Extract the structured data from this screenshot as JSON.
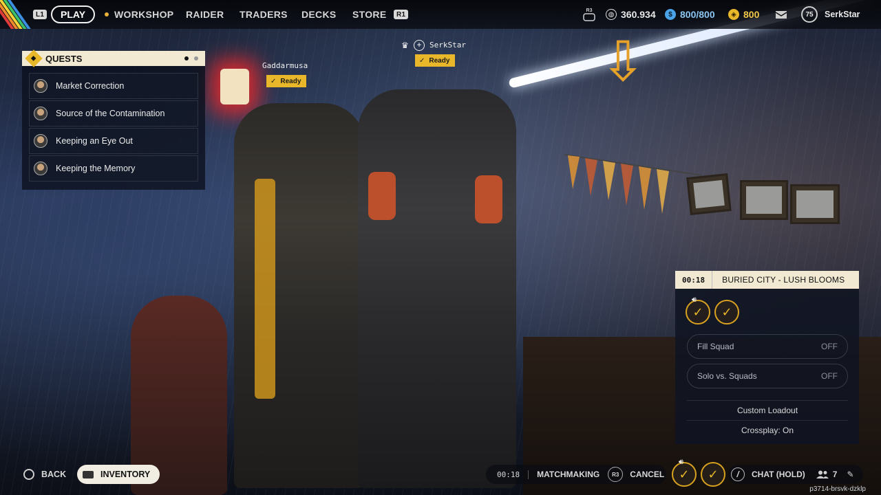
{
  "topbar": {
    "left_bumper": "L1",
    "right_bumper": "R1",
    "tabs": [
      {
        "label": "PLAY",
        "active": true
      },
      {
        "label": "WORKSHOP"
      },
      {
        "label": "RAIDER"
      },
      {
        "label": "TRADERS"
      },
      {
        "label": "DECKS"
      },
      {
        "label": "STORE"
      }
    ],
    "r3_label": "R3",
    "coins": "360.934",
    "cred": "800/800",
    "raider_tokens": "800",
    "level": "75",
    "username": "SerkStar",
    "colors": {
      "cred": "#4aa3e8",
      "tokens": "#e8b82a",
      "accent": "#e8b82a"
    }
  },
  "quests": {
    "title": "QUESTS",
    "items": [
      {
        "label": "Market Correction"
      },
      {
        "label": "Source of the Contamination"
      },
      {
        "label": "Keeping an Eye Out"
      },
      {
        "label": "Keeping the Memory"
      }
    ]
  },
  "players": [
    {
      "name": "Gaddarmusa",
      "status": "Ready"
    },
    {
      "name": "SerkStar",
      "status": "Ready"
    }
  ],
  "matchmaking": {
    "timer": "00:18",
    "map": "BURIED CITY - LUSH BLOOMS",
    "fill_squad": {
      "label": "Fill Squad",
      "value": "OFF"
    },
    "solo_squads": {
      "label": "Solo vs. Squads",
      "value": "OFF"
    },
    "custom_loadout": "Custom Loadout",
    "crossplay": "Crossplay: On"
  },
  "bottombar": {
    "back": "BACK",
    "inventory": "INVENTORY",
    "timer": "00:18",
    "status": "MATCHMAKING",
    "r3": "R3",
    "cancel": "CANCEL",
    "chat": "CHAT (HOLD)",
    "friends_count": "7",
    "session_id": "p3714-brsvk-dzklp"
  }
}
